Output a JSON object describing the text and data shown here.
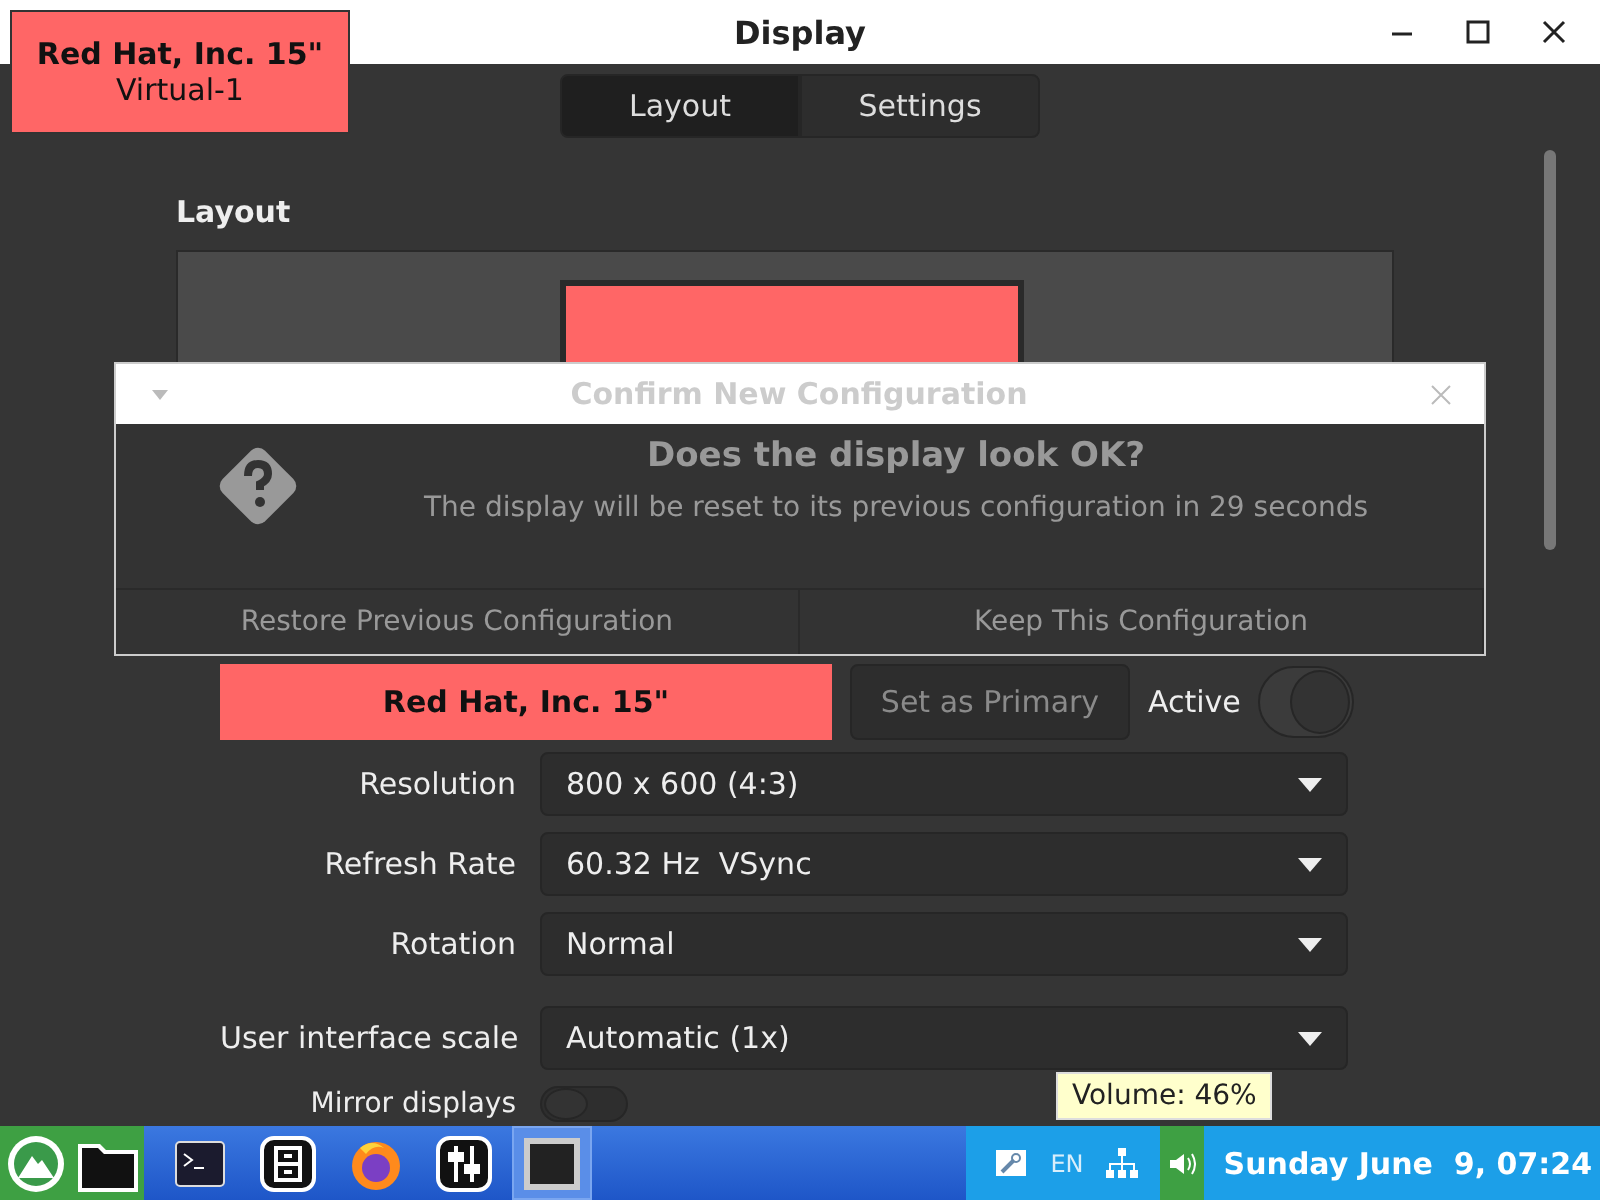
{
  "window": {
    "title": "Display"
  },
  "identify_label": {
    "name": "Red Hat, Inc. 15\"",
    "connector": "Virtual-1"
  },
  "tabs": [
    {
      "label": "Layout",
      "selected": true
    },
    {
      "label": "Settings",
      "selected": false
    }
  ],
  "section_title": "Layout",
  "dialog": {
    "title": "Confirm New Configuration",
    "heading": "Does the display look OK?",
    "message": "The display will be reset to its previous configuration in 29 seconds",
    "buttons": [
      "Restore Previous Configuration",
      "Keep This Configuration"
    ]
  },
  "monitor": {
    "name": "Red Hat, Inc. 15\"",
    "primary_button": {
      "label": "Set as Primary",
      "disabled": true
    },
    "active": {
      "label": "Active",
      "on": true
    }
  },
  "settings": [
    {
      "label": "Resolution",
      "value": "800 x 600 (4:3)"
    },
    {
      "label": "Refresh Rate",
      "value": "60.32 Hz  VSync"
    },
    {
      "label": "Rotation",
      "value": "Normal"
    },
    {
      "label": "User interface scale",
      "value": "Automatic (1x)"
    }
  ],
  "mirror": {
    "label": "Mirror displays",
    "on": false
  },
  "taskbar": {
    "apps": [
      {
        "kind": "start",
        "selected": false
      },
      {
        "kind": "files",
        "selected": false
      },
      {
        "kind": "terminal",
        "selected": false
      },
      {
        "kind": "cabinet",
        "selected": false
      },
      {
        "kind": "browser",
        "selected": false
      },
      {
        "kind": "mixer",
        "selected": false
      },
      {
        "kind": "window",
        "selected": true
      }
    ],
    "language": "EN",
    "clock": "Sunday June  9, 07:24",
    "volume_tooltip": "Volume: 46%"
  }
}
